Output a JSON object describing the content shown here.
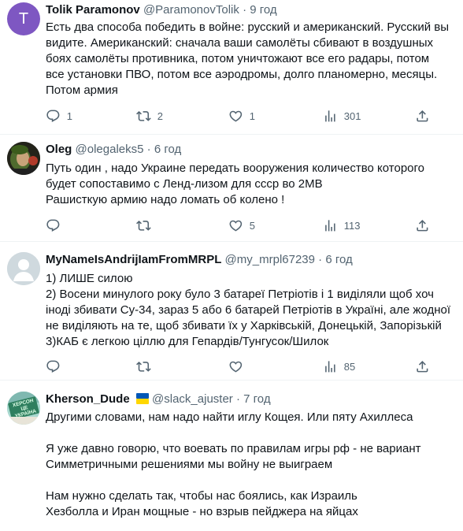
{
  "tweets": [
    {
      "name": "Tolik Paramonov",
      "handle": "@ParamonovTolik",
      "time": "9 год",
      "avatar_letter": "T",
      "avatar_color": "#7e57c2",
      "lines": [
        "Есть два способа победить в войне: русский и американский. Русский вы",
        "видите. Американский: сначала ваши самолёты сбивают в воздушных",
        "боях самолёты противника, потом уничтожают все его радары, потом",
        "все установки ПВО, потом все аэродромы, долго планомерно, месяцы.",
        "Потом армия"
      ],
      "replies": "1",
      "reposts": "2",
      "likes": "1",
      "views": "301"
    },
    {
      "name": "Oleg",
      "handle": "@olegaleks5",
      "time": "6 год",
      "lines": [
        "Путь один , надо Украине передать вооружения количество  которого",
        "будет сопоставимо с Ленд-лизом для ссср во 2МВ",
        "Рашисткую армию надо ломать об колено !"
      ],
      "replies": "",
      "reposts": "",
      "likes": "5",
      "views": "113"
    },
    {
      "name": "MyNameIsAndrijIamFromMRPL",
      "handle": "@my_mrpl67239",
      "time": "6 год",
      "lines": [
        "1) ЛИШЕ силою",
        "2) Восени минулого року було 3 батареї Петріотів і 1 виділяли щоб хоч",
        "іноді збивати Су-34, зараз 5 або 6 батарей Петріотів в Україні, але жодної",
        "не виділяють на те, щоб збивати їх у Харківській, Донецькій, Запорізькій",
        "3)КАБ є легкою ціллю для Гепардів/Тунгусок/Шилок"
      ],
      "replies": "",
      "reposts": "",
      "likes": "",
      "views": "85"
    },
    {
      "name": "Kherson_Dude",
      "handle": "@slack_ajuster",
      "time": "7 год",
      "avatar_text": "ХЕРСОН ЦЕ УКРАЇНА",
      "lines": [
        "Другими словами, нам надо найти иглу Кощея. Или пяту Ахиллеса",
        "",
        "Я уже давно говорю, что воевать по правилам игры рф - не вариант",
        "Симметричными решениями мы войну не выиграем",
        "",
        "Нам нужно сделать так, чтобы нас боялись, как Израиль",
        "Хезболла и Иран мощные - но взрыв пейджера на яйцах"
      ]
    }
  ],
  "dot": "·",
  "colors": {
    "text": "#0f1419",
    "secondary": "#536471",
    "flag_blue": "#0057b7",
    "flag_yellow": "#ffd700"
  }
}
